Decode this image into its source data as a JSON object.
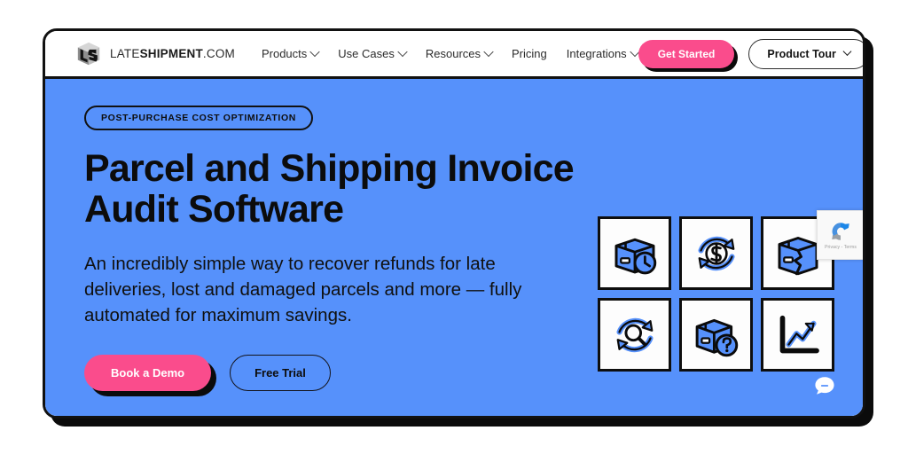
{
  "brand": {
    "logo_icon": "ls-cube-logo-icon",
    "name_light_1": "LATE",
    "name_bold": "SHIPMENT",
    "name_light_2": ".COM"
  },
  "nav": {
    "links": [
      {
        "label": "Products",
        "has_dropdown": true
      },
      {
        "label": "Use Cases",
        "has_dropdown": true
      },
      {
        "label": "Resources",
        "has_dropdown": true
      },
      {
        "label": "Pricing",
        "has_dropdown": false
      },
      {
        "label": "Integrations",
        "has_dropdown": true
      }
    ],
    "get_started_label": "Get Started",
    "product_tour_label": "Product Tour"
  },
  "hero": {
    "badge": "POST-PURCHASE COST OPTIMIZATION",
    "headline": "Parcel and Shipping Invoice Audit Software",
    "subhead": "An incredibly simple way to recover refunds for late deliveries, lost and damaged parcels and more — fully automated for maximum savings.",
    "primary_cta": "Book a Demo",
    "secondary_cta": "Free Trial",
    "icons": [
      {
        "name": "late-delivery-package-clock-icon"
      },
      {
        "name": "refund-dollar-cycle-icon"
      },
      {
        "name": "damaged-package-icon"
      },
      {
        "name": "audit-magnifier-refresh-icon"
      },
      {
        "name": "lost-package-question-icon"
      },
      {
        "name": "savings-analytics-chart-icon"
      }
    ]
  },
  "recaptcha": {
    "text": "Privacy - Terms",
    "icon": "recaptcha-icon"
  },
  "chat": {
    "icon": "chat-bubble-icon"
  },
  "colors": {
    "hero_blue": "#5691FB",
    "accent_pink": "#FA4C8C",
    "ink": "#0e0e0e",
    "white": "#ffffff"
  }
}
